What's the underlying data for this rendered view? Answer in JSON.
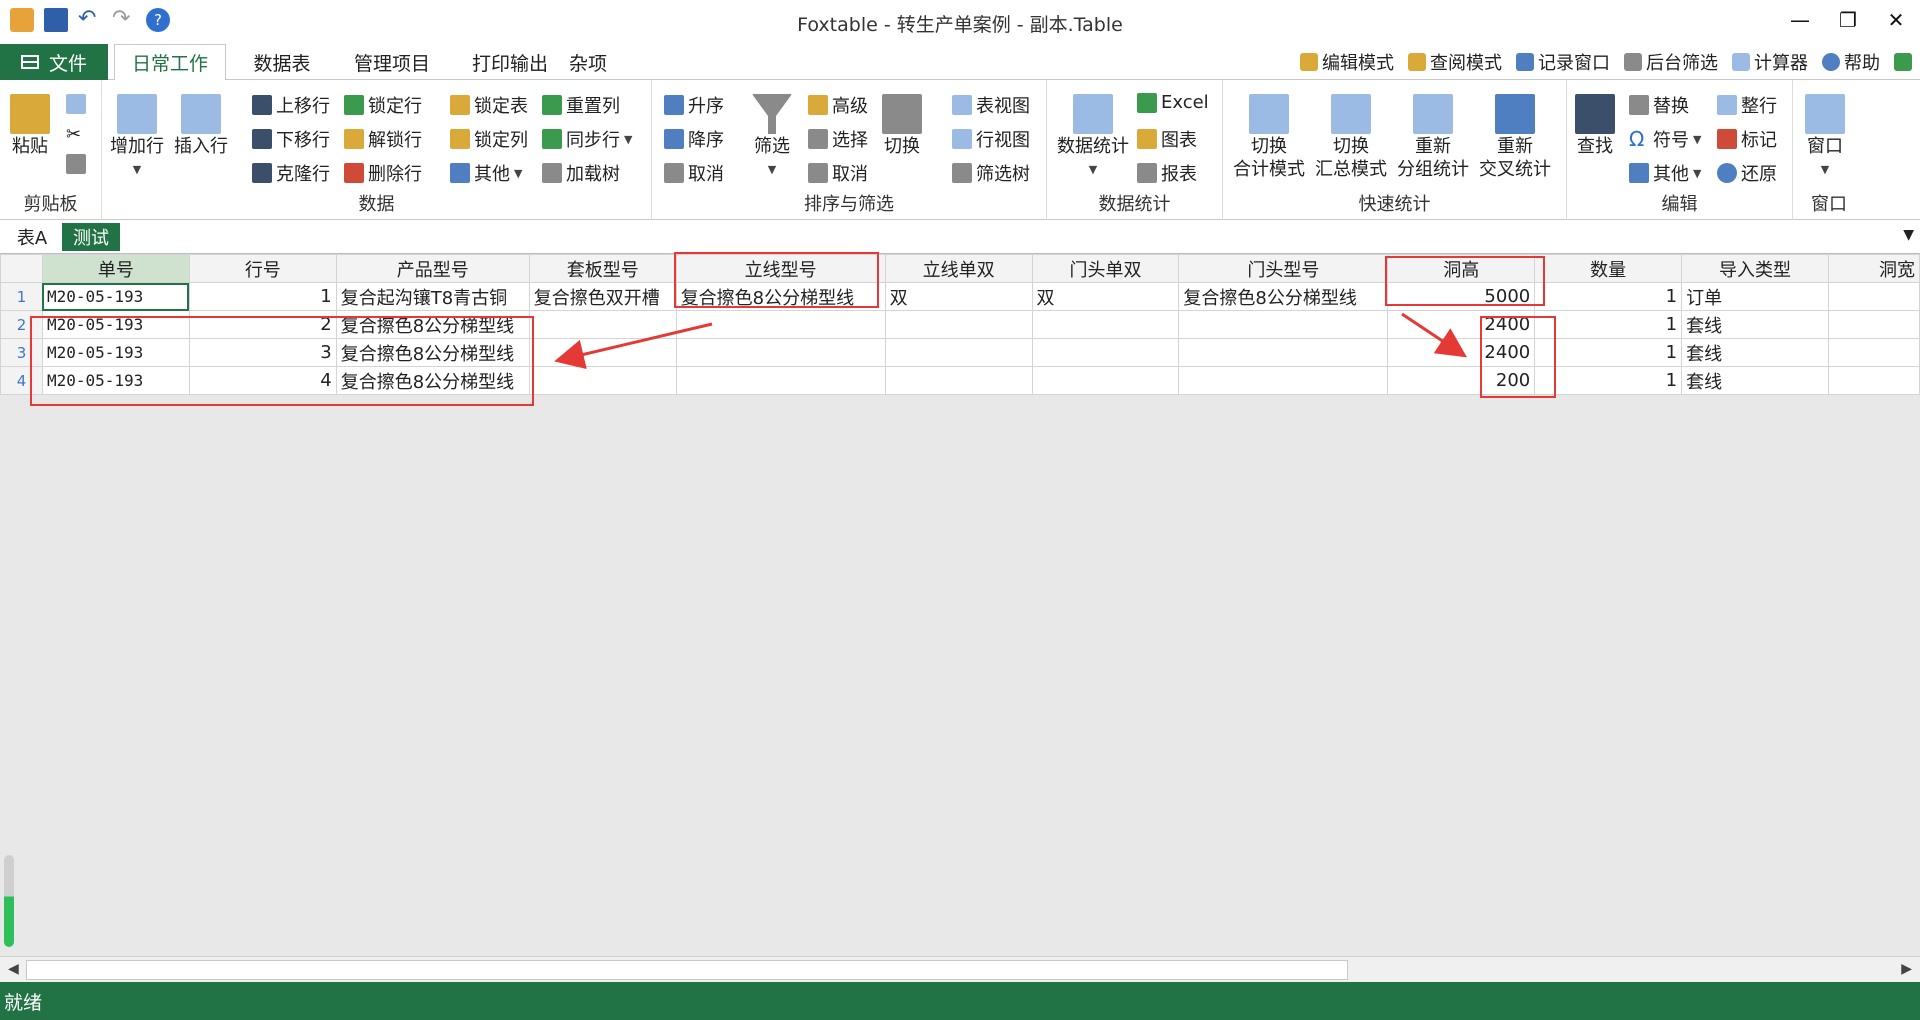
{
  "window": {
    "title": "Foxtable - 转生产单案例 - 副本.Table"
  },
  "ribbon_tabs": {
    "file": "文件",
    "t1": "日常工作",
    "t2": "数据表",
    "t3": "管理项目",
    "t4": "打印输出",
    "t5": "杂项"
  },
  "quick": {
    "edit_mode": "编辑模式",
    "view_mode": "查阅模式",
    "record_window": "记录窗口",
    "bg_filter": "后台筛选",
    "calculator": "计算器",
    "help": "帮助"
  },
  "groups": {
    "clipboard": {
      "label": "剪贴板",
      "paste": "粘贴"
    },
    "data": {
      "label": "数据",
      "add_row": "增加行",
      "insert_row": "插入行",
      "move_up": "上移行",
      "move_down": "下移行",
      "clone_row": "克隆行",
      "lock_row": "锁定行",
      "unlock_row": "解锁行",
      "delete_row": "删除行",
      "lock_table": "锁定表",
      "lock_col": "锁定列",
      "other": "其他",
      "reset_col": "重置列",
      "sync_row": "同步行",
      "load_tree": "加载树"
    },
    "sort": {
      "label": "排序与筛选",
      "asc": "升序",
      "desc": "降序",
      "cancel": "取消",
      "filter": "筛选",
      "advanced": "高级",
      "select": "选择",
      "cancel2": "取消",
      "toggle": "切换",
      "table_view": "表视图",
      "row_view": "行视图",
      "filter_tree": "筛选树"
    },
    "stats": {
      "label": "数据统计",
      "data_stats": "数据统计",
      "excel": "Excel",
      "chart": "图表",
      "report": "报表"
    },
    "quickstats": {
      "label": "快速统计",
      "b1a": "切换",
      "b1b": "合计模式",
      "b2a": "切换",
      "b2b": "汇总模式",
      "b3a": "重新",
      "b3b": "分组统计",
      "b4a": "重新",
      "b4b": "交叉统计"
    },
    "edit": {
      "label": "编辑",
      "find": "查找",
      "replace": "替换",
      "symbol": "符号",
      "other": "其他",
      "tidy": "整行",
      "mark": "标记",
      "restore": "还原"
    },
    "window": {
      "label": "窗口",
      "window": "窗口"
    }
  },
  "sheet_tabs": [
    "表A",
    "测试"
  ],
  "table": {
    "columns": [
      "单号",
      "行号",
      "产品型号",
      "套板型号",
      "立线型号",
      "立线单双",
      "门头单双",
      "门头型号",
      "洞高",
      "数量",
      "导入类型",
      "洞宽"
    ],
    "rows": [
      {
        "n": "1",
        "c": [
          "M20-05-193",
          "1",
          "复合起沟镶T8青古铜",
          "复合擦色双开槽",
          "复合擦色8公分梯型线",
          "双",
          "双",
          "复合擦色8公分梯型线",
          "5000",
          "1",
          "订单",
          ""
        ]
      },
      {
        "n": "2",
        "c": [
          "M20-05-193",
          "2",
          "复合擦色8公分梯型线",
          "",
          "",
          "",
          "",
          "",
          "2400",
          "1",
          "套线",
          ""
        ]
      },
      {
        "n": "3",
        "c": [
          "M20-05-193",
          "3",
          "复合擦色8公分梯型线",
          "",
          "",
          "",
          "",
          "",
          "2400",
          "1",
          "套线",
          ""
        ]
      },
      {
        "n": "4",
        "c": [
          "M20-05-193",
          "4",
          "复合擦色8公分梯型线",
          "",
          "",
          "",
          "",
          "",
          "200",
          "1",
          "套线",
          ""
        ]
      }
    ]
  },
  "status": {
    "text": "就绪"
  }
}
